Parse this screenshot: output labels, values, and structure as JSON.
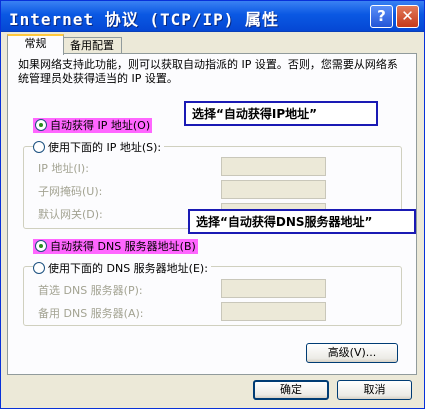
{
  "window": {
    "title": "Internet 协议 (TCP/IP) 属性",
    "help_button": "?",
    "close_button": "✕"
  },
  "tabs": [
    {
      "label": "常规",
      "active": true
    },
    {
      "label": "备用配置",
      "active": false
    }
  ],
  "description": "如果网络支持此功能，则可以获取自动指派的 IP 设置。否则，您需要从网络系统管理员处获得适当的 IP 设置。",
  "ip": {
    "auto_label": "自动获得 IP 地址(O)",
    "auto_selected": true,
    "manual_label": "使用下面的 IP 地址(S):",
    "fields": [
      {
        "label": "IP 地址(I):"
      },
      {
        "label": "子网掩码(U):"
      },
      {
        "label": "默认网关(D):"
      }
    ]
  },
  "dns": {
    "auto_label": "自动获得 DNS 服务器地址(B)",
    "auto_selected": true,
    "manual_label": "使用下面的 DNS 服务器地址(E):",
    "fields": [
      {
        "label": "首选 DNS 服务器(P):"
      },
      {
        "label": "备用 DNS 服务器(A):"
      }
    ]
  },
  "annotations": {
    "ip_callout": "选择“自动获得IP地址”",
    "dns_callout": "选择“自动获得DNS服务器地址”"
  },
  "buttons": {
    "advanced": "高级(V)...",
    "ok": "确定",
    "cancel": "取消"
  },
  "colors": {
    "titlebar": "#0a58e3",
    "highlight": "#ff66ff",
    "callout_border": "#1a1ab4"
  }
}
